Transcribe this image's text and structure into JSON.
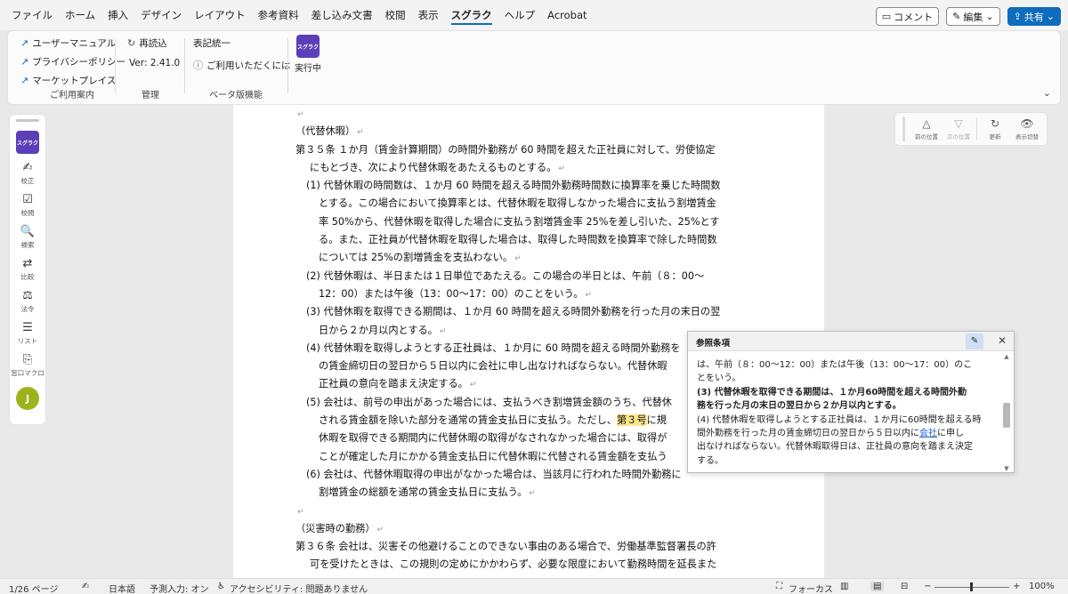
{
  "menu": {
    "tabs": [
      "ファイル",
      "ホーム",
      "挿入",
      "デザイン",
      "レイアウト",
      "参考資料",
      "差し込み文書",
      "校閲",
      "表示",
      "スグラク",
      "ヘルプ",
      "Acrobat"
    ],
    "active_tab": "スグラク",
    "comment_label": "コメント",
    "edit_label": "編集",
    "share_label": "共有"
  },
  "ribbon": {
    "guide": {
      "items": [
        "ユーザーマニュアル",
        "プライバシーポリシー",
        "マーケットプレイス"
      ],
      "label": "ご利用案内"
    },
    "admin": {
      "reload": "再読込",
      "version": "Ver: 2.41.0",
      "label": "管理"
    },
    "beta": {
      "notation": "表記統一",
      "usage": "ご利用いただくには",
      "label": "ベータ版機能"
    },
    "exec": {
      "logo": "スグラク",
      "label": "実行中"
    }
  },
  "sidebar": {
    "logo": "スグラク",
    "items": [
      {
        "icon": "✍",
        "label": "校正"
      },
      {
        "icon": "☑",
        "label": "校閲"
      },
      {
        "icon": "🔍",
        "label": "検索"
      },
      {
        "icon": "⇄",
        "label": "比較"
      },
      {
        "icon": "⚖",
        "label": "法令"
      },
      {
        "icon": "☰",
        "label": "リスト"
      },
      {
        "icon": "⎘",
        "label": "窓口マクロ"
      }
    ],
    "avatar": "J"
  },
  "right_tools": [
    {
      "icon": "△",
      "label": "前の位置"
    },
    {
      "icon": "▽",
      "label": "次の位置"
    },
    {
      "icon": "↻",
      "label": "更新"
    },
    {
      "icon": "👁",
      "label": "表示切替"
    }
  ],
  "doc": {
    "lines": [
      "",
      "（代替休暇）",
      "第３５条 １か月（賃金計算期間）の時間外勤務が 60 時間を超えた正社員に対して、労使協定",
      "にもとづき、次により代替休暇をあたえるものとする。",
      "(1) 代替休暇の時間数は、１か月 60 時間を超える時間外勤務時間数に換算率を乗じた時間数",
      "とする。この場合において換算率とは、代替休暇を取得しなかった場合に支払う割増賃金",
      "率 50%から、代替休暇を取得した場合に支払う割増賃金率 25%を差し引いた、25%とす",
      "る。また、正社員が代替休暇を取得した場合は、取得した時間数を換算率で除した時間数",
      "については 25%の割増賃金を支払わない。",
      "(2) 代替休暇は、半日または１日単位であたえる。この場合の半日とは、午前（８：00～",
      "12：00）または午後（13：00～17：00）のことをいう。",
      "(3) 代替休暇を取得できる期間は、１か月 60 時間を超える時間外勤務を行った月の末日の翌",
      "日から２か月以内とする。",
      "(4) 代替休暇を取得しようとする正社員は、１か月に 60 時間を超える時間外勤務を",
      "の賃金締切日の翌日から５日以内に会社に申し出なければならない。代替休暇",
      "正社員の意向を踏まえ決定する。",
      "(5) 会社は、前号の申出があった場合には、支払うべき割増賃金額のうち、代替休",
      "される賃金額を除いた部分を通常の賃金支払日に支払う。ただし、",
      "第３号",
      "に規",
      "休暇を取得できる期間内に代替休暇の取得がなされなかった場合には、取得が",
      "ことが確定した月にかかる賃金支払日に代替休暇に代替される賃金額を支払う",
      "(6) 会社は、代替休暇取得の申出がなかった場合は、当該月に行われた時間外勤務に",
      "割増賃金の総額を通常の賃金支払日に支払う。",
      "",
      "（災害時の勤務）",
      "第３６条 会社は、災害その他避けることのできない事由のある場合で、労働基準監督署長の許",
      "可を受けたときは、この規則の定めにかかわらず、必要な限度において勤務時間を延長また"
    ]
  },
  "ref_panel": {
    "title": "参照条項",
    "line1": "は、午前（８：00～12：00）または午後（13：00～17：00）のこ",
    "line2": "とをいう。",
    "line3": "(3) 代替休暇を取得できる期間は、１か月60時間を超える時間外勤",
    "line4": "務を行った月の末日の翌日から２か月以内とする。",
    "line5": "(4) 代替休暇を取得しようとする正社員は、１か月に60時間を超える時",
    "line6a": "間外勤務を行った月の賃金締切日の翌日から５日以内に",
    "line6link": "会社",
    "line6b": "に申し",
    "line7": "出なければならない。代替休暇取得日は、正社員の意向を踏まえ決定",
    "line8": "する。"
  },
  "status": {
    "page": "1/26 ページ",
    "lang": "日本語",
    "predict": "予測入力: オン",
    "access": "アクセシビリティ: 問題ありません",
    "focus": "フォーカス",
    "zoom": "100%"
  },
  "colors": {
    "accent": "#0f6cbd",
    "logo": "#5b3fb8",
    "avatar": "#9cb31e",
    "highlight": "#fde68a"
  }
}
